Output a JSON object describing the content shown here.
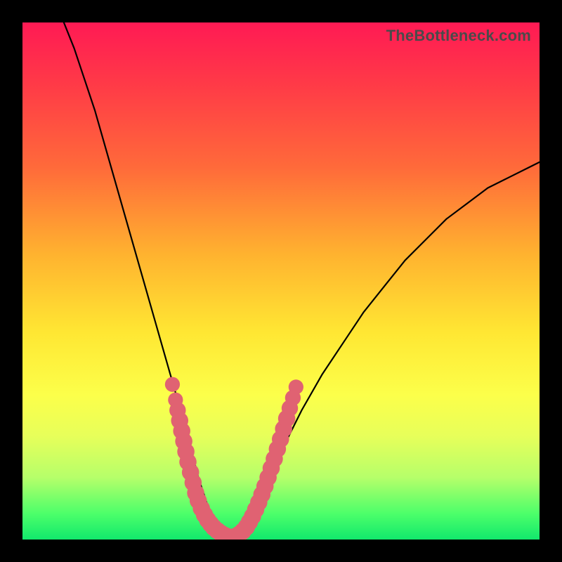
{
  "watermark": "TheBottleneck.com",
  "chart_data": {
    "type": "line",
    "title": "",
    "xlabel": "",
    "ylabel": "",
    "xlim": [
      0,
      100
    ],
    "ylim": [
      0,
      100
    ],
    "series": [
      {
        "name": "bottleneck-curve",
        "x": [
          8,
          10,
          12,
          14,
          16,
          18,
          20,
          22,
          24,
          26,
          28,
          30,
          32,
          33,
          34,
          35,
          36,
          37,
          38,
          39,
          40,
          42,
          44,
          46,
          48,
          50,
          54,
          58,
          62,
          66,
          70,
          74,
          78,
          82,
          86,
          90,
          94,
          98,
          100
        ],
        "y": [
          100,
          95,
          89,
          83,
          76,
          69,
          62,
          55,
          48,
          41,
          34,
          27,
          20,
          16,
          12,
          9,
          6,
          4,
          2,
          1,
          0,
          2,
          5,
          9,
          13,
          17,
          25,
          32,
          38,
          44,
          49,
          54,
          58,
          62,
          65,
          68,
          70,
          72,
          73
        ]
      }
    ],
    "markers": {
      "name": "highlight-dots",
      "color": "#e06272",
      "points": [
        {
          "x": 29.0,
          "y": 30.0,
          "r": 1.2
        },
        {
          "x": 29.6,
          "y": 27.0,
          "r": 1.2
        },
        {
          "x": 30.0,
          "y": 25.0,
          "r": 1.4
        },
        {
          "x": 30.4,
          "y": 23.0,
          "r": 1.5
        },
        {
          "x": 30.8,
          "y": 21.0,
          "r": 1.5
        },
        {
          "x": 31.2,
          "y": 19.0,
          "r": 1.5
        },
        {
          "x": 31.6,
          "y": 17.0,
          "r": 1.5
        },
        {
          "x": 32.0,
          "y": 15.0,
          "r": 1.5
        },
        {
          "x": 32.5,
          "y": 13.0,
          "r": 1.5
        },
        {
          "x": 33.0,
          "y": 11.0,
          "r": 1.5
        },
        {
          "x": 33.5,
          "y": 9.0,
          "r": 1.5
        },
        {
          "x": 34.0,
          "y": 7.5,
          "r": 1.5
        },
        {
          "x": 34.6,
          "y": 6.0,
          "r": 1.5
        },
        {
          "x": 35.2,
          "y": 4.8,
          "r": 1.5
        },
        {
          "x": 35.8,
          "y": 3.8,
          "r": 1.5
        },
        {
          "x": 36.4,
          "y": 3.0,
          "r": 1.5
        },
        {
          "x": 37.0,
          "y": 2.3,
          "r": 1.5
        },
        {
          "x": 37.7,
          "y": 1.7,
          "r": 1.5
        },
        {
          "x": 38.4,
          "y": 1.2,
          "r": 1.5
        },
        {
          "x": 39.1,
          "y": 0.8,
          "r": 1.5
        },
        {
          "x": 39.8,
          "y": 0.5,
          "r": 1.5
        },
        {
          "x": 40.5,
          "y": 0.4,
          "r": 1.5
        },
        {
          "x": 41.2,
          "y": 0.6,
          "r": 1.5
        },
        {
          "x": 41.9,
          "y": 1.0,
          "r": 1.5
        },
        {
          "x": 42.6,
          "y": 1.6,
          "r": 1.5
        },
        {
          "x": 43.3,
          "y": 2.4,
          "r": 1.5
        },
        {
          "x": 43.9,
          "y": 3.4,
          "r": 1.5
        },
        {
          "x": 44.5,
          "y": 4.5,
          "r": 1.5
        },
        {
          "x": 45.1,
          "y": 5.8,
          "r": 1.5
        },
        {
          "x": 45.7,
          "y": 7.2,
          "r": 1.5
        },
        {
          "x": 46.3,
          "y": 8.7,
          "r": 1.5
        },
        {
          "x": 46.9,
          "y": 10.3,
          "r": 1.5
        },
        {
          "x": 47.5,
          "y": 12.0,
          "r": 1.5
        },
        {
          "x": 48.1,
          "y": 13.8,
          "r": 1.5
        },
        {
          "x": 48.7,
          "y": 15.6,
          "r": 1.5
        },
        {
          "x": 49.3,
          "y": 17.5,
          "r": 1.5
        },
        {
          "x": 49.9,
          "y": 19.4,
          "r": 1.5
        },
        {
          "x": 50.5,
          "y": 21.4,
          "r": 1.5
        },
        {
          "x": 51.1,
          "y": 23.4,
          "r": 1.5
        },
        {
          "x": 51.7,
          "y": 25.4,
          "r": 1.4
        },
        {
          "x": 52.3,
          "y": 27.4,
          "r": 1.3
        },
        {
          "x": 52.9,
          "y": 29.5,
          "r": 1.2
        }
      ]
    }
  }
}
